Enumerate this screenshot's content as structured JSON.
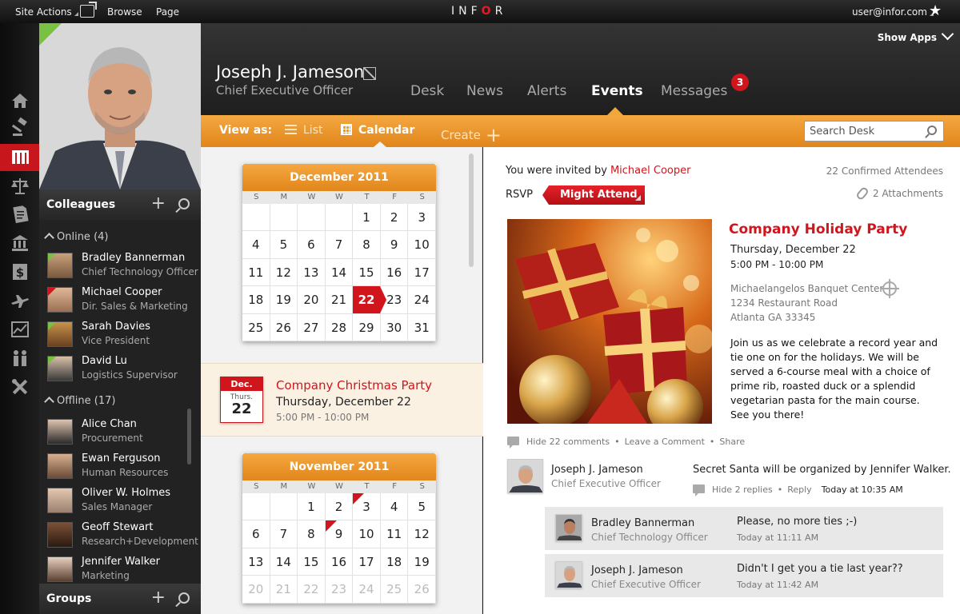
{
  "topbar": {
    "site_actions": "Site Actions",
    "browse": "Browse",
    "page": "Page",
    "logo_pre": "INF",
    "logo_accent": "O",
    "logo_post": "R",
    "user_email": "user@infor.com",
    "star_icon": "★"
  },
  "nav_icons": [
    "home-icon",
    "gavel-icon",
    "organization-icon",
    "scales-icon",
    "document-icon",
    "bank-icon",
    "dollar-icon",
    "airplane-icon",
    "chart-icon",
    "people-icon",
    "tools-icon"
  ],
  "profile": {
    "name": "Joseph J. Jameson",
    "title": "Chief Executive Officer"
  },
  "colleagues": {
    "heading": "Colleagues",
    "online_label": "Online (4)",
    "offline_label": "Offline (17)",
    "online": [
      {
        "name": "Bradley Bannerman",
        "title": "Chief Technology Officer",
        "status": "green"
      },
      {
        "name": "Michael Cooper",
        "title": "Dir. Sales & Marketing",
        "status": "red"
      },
      {
        "name": "Sarah Davies",
        "title": "Vice President",
        "status": "green"
      },
      {
        "name": "David Lu",
        "title": "Logistics Supervisor",
        "status": "green"
      }
    ],
    "offline": [
      {
        "name": "Alice Chan",
        "title": "Procurement"
      },
      {
        "name": "Ewan Ferguson",
        "title": "Human Resources"
      },
      {
        "name": "Oliver W. Holmes",
        "title": "Sales Manager"
      },
      {
        "name": "Geoff Stewart",
        "title": "Research+Development"
      },
      {
        "name": "Jennifer Walker",
        "title": "Marketing"
      }
    ]
  },
  "groups": {
    "heading": "Groups"
  },
  "header": {
    "show_apps": "Show Apps",
    "tabs": [
      {
        "label": "Desk",
        "active": false
      },
      {
        "label": "News",
        "active": false
      },
      {
        "label": "Alerts",
        "active": false
      },
      {
        "label": "Events",
        "active": true
      },
      {
        "label": "Messages",
        "active": false
      }
    ],
    "messages_badge": "3"
  },
  "toolbar": {
    "view_as": "View as:",
    "list": "List",
    "calendar": "Calendar",
    "create": "Create",
    "search_placeholder": "Search Desk"
  },
  "calendars": [
    {
      "title": "December 2011",
      "dow": [
        "S",
        "M",
        "W",
        "W",
        "T",
        "F",
        "S"
      ],
      "weeks": [
        [
          "",
          "",
          "",
          "",
          "1",
          "2",
          "3"
        ],
        [
          "4",
          "5",
          "6",
          "7",
          "8",
          "9",
          "10"
        ],
        [
          "11",
          "12",
          "13",
          "14",
          "15",
          "16",
          "17"
        ],
        [
          "18",
          "19",
          "20",
          "21",
          "22",
          "23",
          "24"
        ],
        [
          "25",
          "26",
          "27",
          "28",
          "29",
          "30",
          "31"
        ]
      ],
      "selected": "22",
      "marked": []
    },
    {
      "title": "November 2011",
      "dow": [
        "S",
        "M",
        "W",
        "W",
        "T",
        "F",
        "S"
      ],
      "weeks": [
        [
          "",
          "",
          "1",
          "2",
          "3",
          "4",
          "5"
        ],
        [
          "6",
          "7",
          "8",
          "9",
          "10",
          "11",
          "12"
        ],
        [
          "13",
          "14",
          "15",
          "16",
          "17",
          "18",
          "19"
        ],
        [
          "20",
          "21",
          "22",
          "23",
          "24",
          "25",
          "26"
        ]
      ],
      "selected": "",
      "marked": [
        "3",
        "9"
      ],
      "muted_from_row": 2
    }
  ],
  "event_card": {
    "month": "Dec.",
    "weekday": "Thurs.",
    "day": "22",
    "title": "Company Christmas Party",
    "date": "Thursday, December 22",
    "time": "5:00 PM - 10:00 PM"
  },
  "detail": {
    "invited_by_label": "You were invited by",
    "invited_by": "Michael Cooper",
    "attendees": "22 Confirmed Attendees",
    "rsvp_label": "RSVP",
    "rsvp_value": "Might Attend",
    "attachments": "2 Attachments",
    "title": "Company Holiday Party",
    "date": "Thursday, December 22",
    "time": "5:00 PM - 10:00 PM",
    "venue": "Michaelangelos Banquet Center",
    "address1": "1234 Restaurant Road",
    "address2": "Atlanta GA 33345",
    "description": "Join us as we celebrate a record year and tie one on for the holidays. We will be served a 6-course meal with a choice of prime rib, roasted duck or a splendid vegetarian pasta for the main course.",
    "description_end": "See you there!",
    "actions": {
      "hide_comments": "Hide 22 comments",
      "leave_comment": "Leave a Comment",
      "share": "Share",
      "sep": "•"
    }
  },
  "comments": {
    "main": {
      "name": "Joseph J. Jameson",
      "role": "Chief Executive Officer",
      "text": "Secret Santa will be organized by Jennifer Walker.",
      "hide_replies": "Hide 2 replies",
      "reply": "Reply",
      "sep": "•",
      "time": "Today at 10:35 AM"
    },
    "replies": [
      {
        "name": "Bradley Bannerman",
        "role": "Chief Technology Officer",
        "text": "Please, no more ties ;-)",
        "time": "Today at 11:11 AM"
      },
      {
        "name": "Joseph J. Jameson",
        "role": "Chief Executive Officer",
        "text": "Didn't I get you a tie last year??",
        "time": "Today at 11:42 AM"
      }
    ]
  },
  "colors": {
    "accent_red": "#d1151d",
    "orange": "#f0a73a",
    "online": "#7ac143"
  }
}
